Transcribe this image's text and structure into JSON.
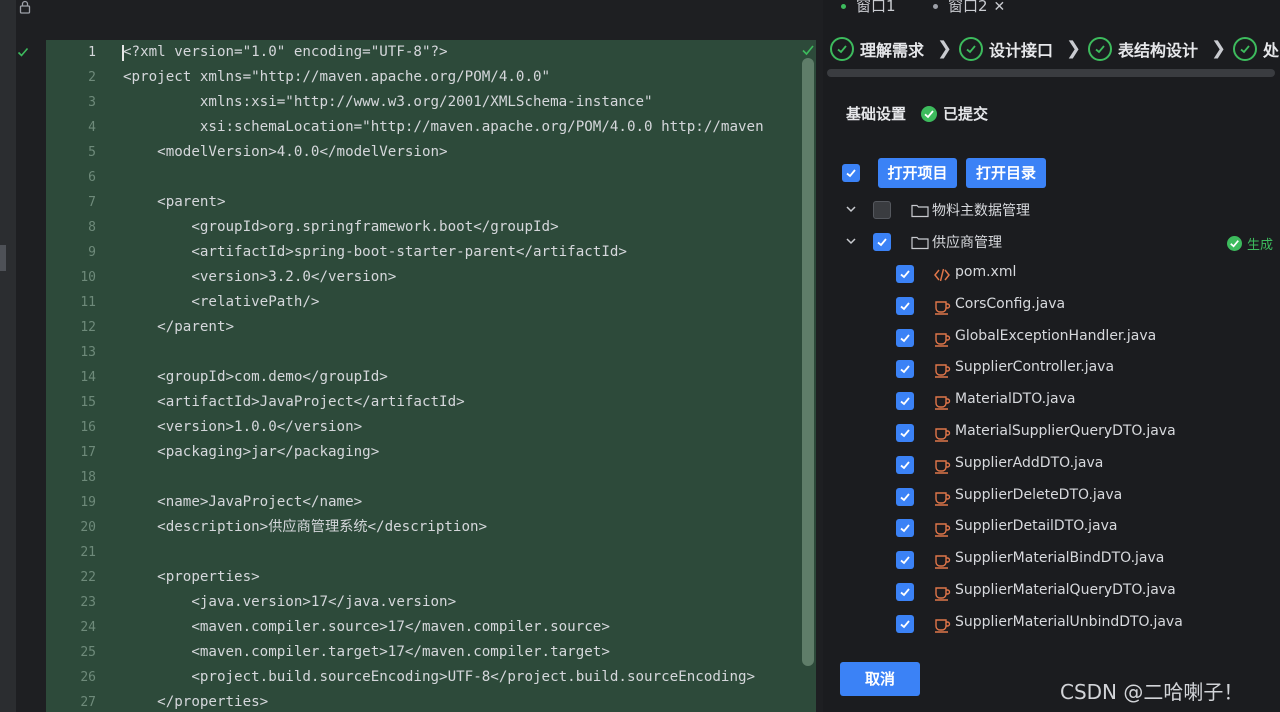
{
  "editor": {
    "lines": [
      {
        "n": "1",
        "text": "<?xml version=\"1.0\" encoding=\"UTF-8\"?>"
      },
      {
        "n": "2",
        "text": "<project xmlns=\"http://maven.apache.org/POM/4.0.0\""
      },
      {
        "n": "3",
        "text": "         xmlns:xsi=\"http://www.w3.org/2001/XMLSchema-instance\""
      },
      {
        "n": "4",
        "text": "         xsi:schemaLocation=\"http://maven.apache.org/POM/4.0.0 http://maven"
      },
      {
        "n": "5",
        "text": "    <modelVersion>4.0.0</modelVersion>"
      },
      {
        "n": "6",
        "text": ""
      },
      {
        "n": "7",
        "text": "    <parent>"
      },
      {
        "n": "8",
        "text": "        <groupId>org.springframework.boot</groupId>"
      },
      {
        "n": "9",
        "text": "        <artifactId>spring-boot-starter-parent</artifactId>"
      },
      {
        "n": "10",
        "text": "        <version>3.2.0</version>"
      },
      {
        "n": "11",
        "text": "        <relativePath/>"
      },
      {
        "n": "12",
        "text": "    </parent>"
      },
      {
        "n": "13",
        "text": ""
      },
      {
        "n": "14",
        "text": "    <groupId>com.demo</groupId>"
      },
      {
        "n": "15",
        "text": "    <artifactId>JavaProject</artifactId>"
      },
      {
        "n": "16",
        "text": "    <version>1.0.0</version>"
      },
      {
        "n": "17",
        "text": "    <packaging>jar</packaging>"
      },
      {
        "n": "18",
        "text": ""
      },
      {
        "n": "19",
        "text": "    <name>JavaProject</name>"
      },
      {
        "n": "20",
        "text": "    <description>供应商管理系统</description>"
      },
      {
        "n": "21",
        "text": ""
      },
      {
        "n": "22",
        "text": "    <properties>"
      },
      {
        "n": "23",
        "text": "        <java.version>17</java.version>"
      },
      {
        "n": "24",
        "text": "        <maven.compiler.source>17</maven.compiler.source>"
      },
      {
        "n": "25",
        "text": "        <maven.compiler.target>17</maven.compiler.target>"
      },
      {
        "n": "26",
        "text": "        <project.build.sourceEncoding>UTF-8</project.build.sourceEncoding>"
      },
      {
        "n": "27",
        "text": "    </properties>"
      }
    ],
    "gutter_top": "1",
    "colors": {
      "background": "#2d4a3a",
      "text": "#d5d7db"
    }
  },
  "panel": {
    "tabs": [
      {
        "label": "窗口1",
        "dot_color": "#3dbb5d"
      },
      {
        "label": "窗口2",
        "dot_color": "#9da0a8",
        "close": "✕"
      }
    ],
    "steps": [
      "理解需求",
      "设计接口",
      "表结构设计",
      "处"
    ],
    "settings_title": "基础设置",
    "status": "已提交",
    "buttons": {
      "open_project": "打开项目",
      "open_dir": "打开目录",
      "cancel": "取消"
    },
    "folders": [
      {
        "name": "物料主数据管理",
        "checked": false
      },
      {
        "name": "供应商管理",
        "checked": true,
        "status": "生成"
      }
    ],
    "files": [
      {
        "name": "pom.xml",
        "icon": "xml-code-icon"
      },
      {
        "name": "CorsConfig.java",
        "icon": "java-file-icon"
      },
      {
        "name": "GlobalExceptionHandler.java",
        "icon": "java-file-icon"
      },
      {
        "name": "SupplierController.java",
        "icon": "java-file-icon"
      },
      {
        "name": "MaterialDTO.java",
        "icon": "java-file-icon"
      },
      {
        "name": "MaterialSupplierQueryDTO.java",
        "icon": "java-file-icon"
      },
      {
        "name": "SupplierAddDTO.java",
        "icon": "java-file-icon"
      },
      {
        "name": "SupplierDeleteDTO.java",
        "icon": "java-file-icon"
      },
      {
        "name": "SupplierDetailDTO.java",
        "icon": "java-file-icon"
      },
      {
        "name": "SupplierMaterialBindDTO.java",
        "icon": "java-file-icon"
      },
      {
        "name": "SupplierMaterialQueryDTO.java",
        "icon": "java-file-icon"
      },
      {
        "name": "SupplierMaterialUnbindDTO.java",
        "icon": "java-file-icon"
      }
    ],
    "colors": {
      "accent": "#3b82f6",
      "success": "#3dbb5d",
      "java_icon": "#e0764a"
    }
  },
  "watermark": "CSDN @二哈喇子！"
}
